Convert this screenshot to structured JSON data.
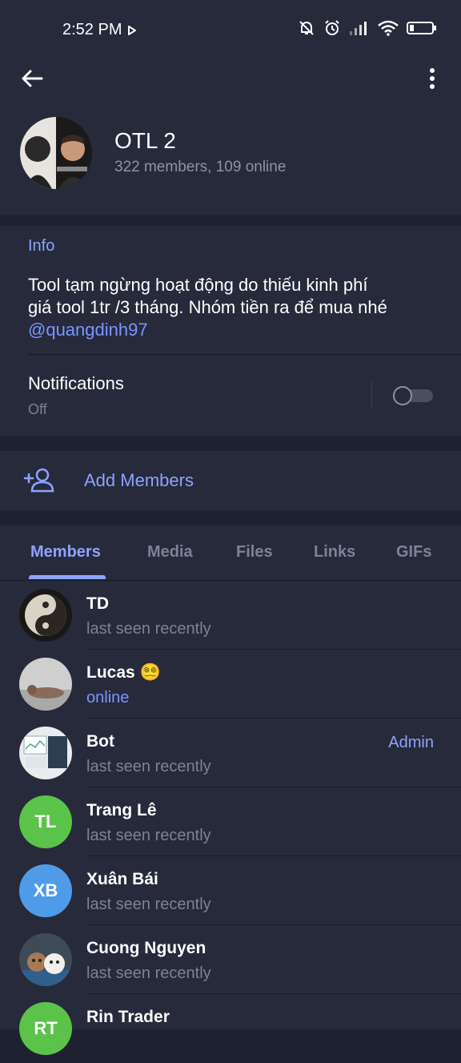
{
  "status_bar": {
    "time": "2:52 PM"
  },
  "group": {
    "title": "OTL 2",
    "subtitle": "322 members, 109 online"
  },
  "info": {
    "heading": "Info",
    "line1": "Tool tạm ngừng hoạt động do thiếu kinh phí",
    "line2": "giá tool 1tr /3 tháng. Nhóm tiền ra để mua nhé",
    "link": "@quangdinh97"
  },
  "notifications": {
    "label": "Notifications",
    "status": "Off",
    "enabled": false
  },
  "add_members": {
    "label": "Add Members"
  },
  "tabs": [
    {
      "label": "Members",
      "active": true
    },
    {
      "label": "Media",
      "active": false
    },
    {
      "label": "Files",
      "active": false
    },
    {
      "label": "Links",
      "active": false
    },
    {
      "label": "GIFs",
      "active": false
    }
  ],
  "members": [
    {
      "name": "TD",
      "status": "last seen recently",
      "online": false,
      "badge": "",
      "initials": ""
    },
    {
      "name": "Lucas 😵‍💫",
      "status": "online",
      "online": true,
      "badge": "",
      "initials": ""
    },
    {
      "name": "Bot",
      "status": "last seen recently",
      "online": false,
      "badge": "Admin",
      "initials": ""
    },
    {
      "name": "Trang Lê",
      "status": "last seen recently",
      "online": false,
      "badge": "",
      "initials": "TL",
      "color": "#5cc34a"
    },
    {
      "name": "Xuân Bái",
      "status": "last seen recently",
      "online": false,
      "badge": "",
      "initials": "XB",
      "color": "#4f9be8"
    },
    {
      "name": "Cuong Nguyen",
      "status": "last seen recently",
      "online": false,
      "badge": "",
      "initials": ""
    },
    {
      "name": "Rin Trader",
      "status": "",
      "online": false,
      "badge": "",
      "initials": "RT",
      "color": "#5cc34a"
    }
  ],
  "colors": {
    "accent": "#8ea3ff",
    "background": "#1e2230",
    "panel": "#262a3b"
  }
}
